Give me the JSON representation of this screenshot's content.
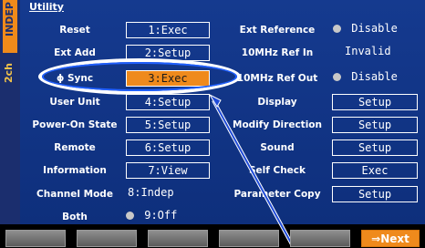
{
  "title": "Utility",
  "channel": {
    "tab": "INDEP",
    "sub": "2ch"
  },
  "left": {
    "rows": [
      {
        "label": "Reset",
        "value": "1:Exec"
      },
      {
        "label": "Ext Add",
        "value": "2:Setup"
      },
      {
        "label": "ϕ Sync",
        "value": "3:Exec"
      },
      {
        "label": "User Unit",
        "value": "4:Setup"
      },
      {
        "label": "Power-On State",
        "value": "5:Setup"
      },
      {
        "label": "Remote",
        "value": "6:Setup"
      },
      {
        "label": "Information",
        "value": "7:View"
      },
      {
        "label": "Channel Mode",
        "value": "8:Indep"
      },
      {
        "label": "Both",
        "value": "9:Off"
      }
    ]
  },
  "right": {
    "rows": [
      {
        "label": "Ext Reference",
        "value": "Disable"
      },
      {
        "label": "10MHz Ref In",
        "value": "Invalid"
      },
      {
        "label": "10MHz Ref Out",
        "value": "Disable"
      },
      {
        "label": "Display",
        "value": "Setup"
      },
      {
        "label": "Modify Direction",
        "value": "Setup"
      },
      {
        "label": "Sound",
        "value": "Setup"
      },
      {
        "label": "Self Check",
        "value": "Exec"
      },
      {
        "label": "Parameter Copy",
        "value": "Setup"
      }
    ]
  },
  "bottom": {
    "next_label": "⇒Next"
  }
}
